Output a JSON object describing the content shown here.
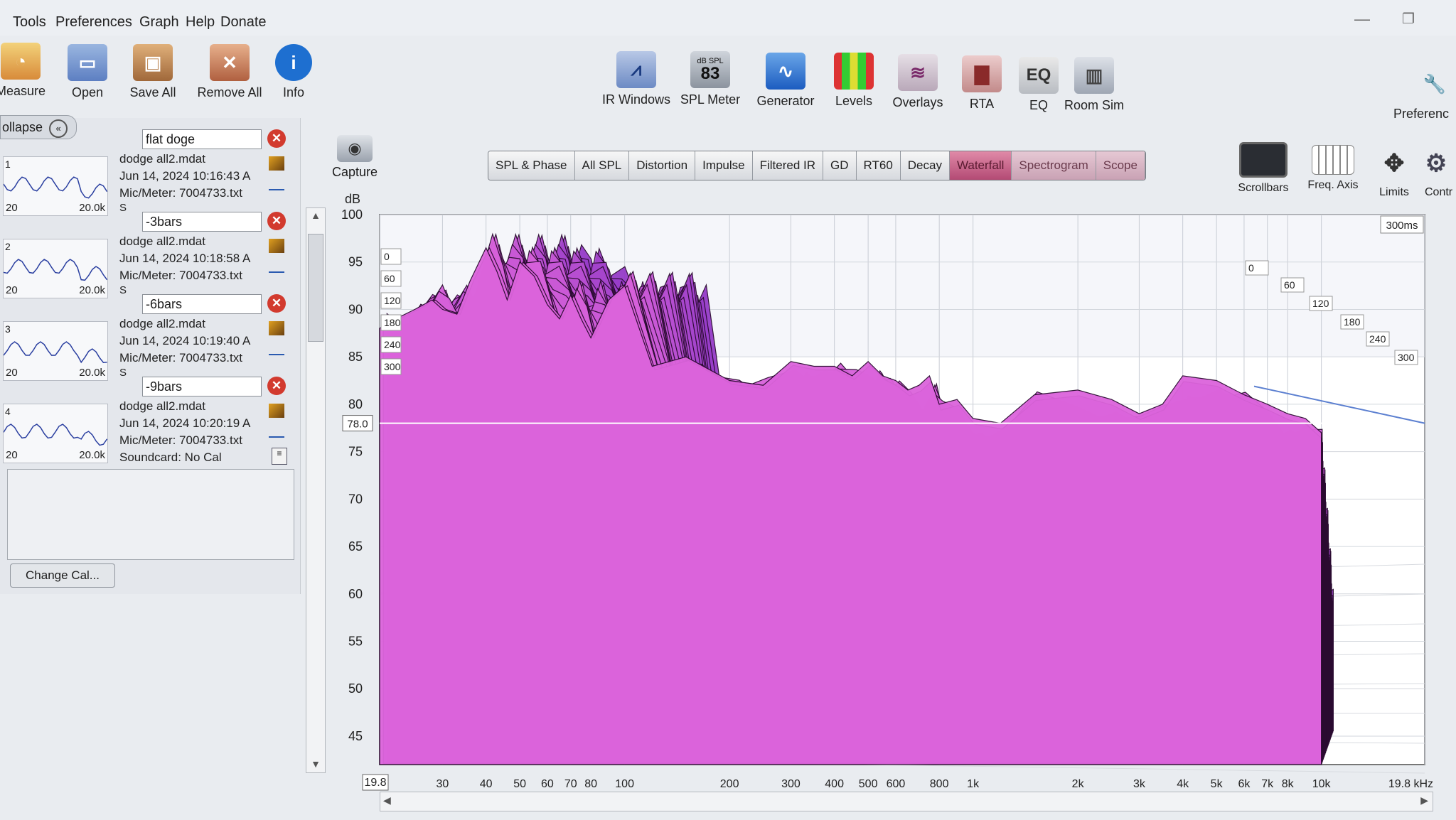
{
  "menu": [
    "Tools",
    "Preferences",
    "Graph",
    "Help",
    "Donate"
  ],
  "toolbar_left": [
    {
      "label": "Measure",
      "icon": "measure-icon"
    },
    {
      "label": "Open",
      "icon": "open-folder-icon"
    },
    {
      "label": "Save All",
      "icon": "save-icon"
    },
    {
      "label": "Remove All",
      "icon": "remove-icon"
    },
    {
      "label": "Info",
      "icon": "info-icon"
    }
  ],
  "toolbar_right": [
    {
      "label": "IR Windows",
      "icon": "ir-windows-icon"
    },
    {
      "label": "SPL Meter",
      "icon": "spl-meter-icon",
      "badge_top": "dB SPL",
      "badge_value": "83"
    },
    {
      "label": "Generator",
      "icon": "generator-icon"
    },
    {
      "label": "Levels",
      "icon": "levels-icon"
    },
    {
      "label": "Overlays",
      "icon": "overlays-icon"
    },
    {
      "label": "RTA",
      "icon": "rta-icon"
    },
    {
      "label": "EQ",
      "icon": "eq-icon",
      "badge_value": "EQ"
    },
    {
      "label": "Room Sim",
      "icon": "room-sim-icon"
    },
    {
      "label": "Preferenc",
      "icon": "preferences-icon"
    }
  ],
  "graph_tools": [
    {
      "label": "Scrollbars",
      "icon": "scrollbars-icon"
    },
    {
      "label": "Freq. Axis",
      "icon": "freq-axis-icon"
    },
    {
      "label": "Limits",
      "icon": "limits-icon"
    },
    {
      "label": "Contr",
      "icon": "controls-icon"
    }
  ],
  "capture": {
    "label": "Capture",
    "icon": "camera-icon"
  },
  "collapse": {
    "label": "ollapse",
    "icon": "double-chevron-left-icon"
  },
  "measurements": [
    {
      "name": "flat doge",
      "number": "1",
      "file": "dodge all2.mdat",
      "date": "Jun 14, 2024 10:16:43 A",
      "mic": "Mic/Meter: 7004733.txt",
      "extra": "S",
      "tmin": "20",
      "tmax": "20.0k"
    },
    {
      "name": "-3bars",
      "number": "2",
      "file": "dodge all2.mdat",
      "date": "Jun 14, 2024 10:18:58 A",
      "mic": "Mic/Meter: 7004733.txt",
      "extra": "S",
      "tmin": "20",
      "tmax": "20.0k"
    },
    {
      "name": "-6bars",
      "number": "3",
      "file": "dodge all2.mdat",
      "date": "Jun 14, 2024 10:19:40 A",
      "mic": "Mic/Meter: 7004733.txt",
      "extra": "S",
      "tmin": "20",
      "tmax": "20.0k"
    },
    {
      "name": "-9bars",
      "number": "4",
      "file": "dodge all2.mdat",
      "date": "Jun 14, 2024 10:20:19 A",
      "mic": "Mic/Meter: 7004733.txt",
      "extra": "Soundcard: No Cal",
      "tmin": "20",
      "tmax": "20.0k"
    }
  ],
  "change_cal": "Change Cal...",
  "tabs": [
    {
      "label": "SPL & Phase",
      "state": "normal"
    },
    {
      "label": "All SPL",
      "state": "normal"
    },
    {
      "label": "Distortion",
      "state": "normal"
    },
    {
      "label": "Impulse",
      "state": "normal"
    },
    {
      "label": "Filtered IR",
      "state": "normal"
    },
    {
      "label": "GD",
      "state": "normal"
    },
    {
      "label": "RT60",
      "state": "normal"
    },
    {
      "label": "Decay",
      "state": "normal"
    },
    {
      "label": "Waterfall",
      "state": "active"
    },
    {
      "label": "Spectrogram",
      "state": "dim"
    },
    {
      "label": "Scope",
      "state": "dim"
    }
  ],
  "chart_data": {
    "type": "area",
    "ylabel": "dB",
    "ylim": [
      42,
      100
    ],
    "yticks": [
      "100",
      "95",
      "90",
      "85",
      "80",
      "75",
      "70",
      "65",
      "60",
      "55",
      "50",
      "45"
    ],
    "cursor_value": "78.0",
    "cursor_db": 78,
    "xscale": "log",
    "xlim": [
      19.8,
      19800
    ],
    "xticks": [
      "19.8",
      "30",
      "40",
      "50",
      "60",
      "70",
      "80",
      "100",
      "200",
      "300",
      "400",
      "500",
      "600",
      "800",
      "1k",
      "2k",
      "3k",
      "4k",
      "5k",
      "6k",
      "7k",
      "8k",
      "10k",
      "19.8 kHz"
    ],
    "xtick_values": [
      19.8,
      30,
      40,
      50,
      60,
      70,
      80,
      100,
      200,
      300,
      400,
      500,
      600,
      800,
      1000,
      2000,
      3000,
      4000,
      5000,
      6000,
      7000,
      8000,
      10000,
      19800
    ],
    "time_label": "300ms",
    "time_slices_front": [
      "0",
      "60",
      "120",
      "180",
      "240",
      "300"
    ],
    "time_slices_back": [
      "0",
      "60",
      "120",
      "180",
      "240",
      "300"
    ],
    "series_color": "#c050d8",
    "front_spectrum": {
      "freq": [
        19.8,
        22,
        25,
        28,
        30,
        33,
        36,
        40,
        43,
        46,
        50,
        55,
        60,
        65,
        70,
        75,
        80,
        90,
        100,
        120,
        150,
        200,
        250,
        300,
        350,
        400,
        450,
        500,
        550,
        600,
        650,
        700,
        750,
        800,
        900,
        1000,
        1200,
        1500,
        2000,
        2500,
        3000,
        3500,
        4000,
        5000,
        6000,
        7000,
        8000,
        9000,
        10000
      ],
      "db": [
        88,
        89,
        90,
        91,
        90,
        89.5,
        93,
        96.5,
        94,
        91,
        95,
        93.5,
        90.5,
        89,
        91.5,
        89,
        87,
        91,
        92.5,
        84,
        85,
        82.5,
        82,
        84.5,
        84,
        84,
        83,
        84.5,
        83,
        82.5,
        81.5,
        82,
        83,
        80,
        80.5,
        78.5,
        78,
        81,
        81.5,
        80.5,
        79,
        80,
        83,
        82.5,
        81,
        80,
        79,
        78.5,
        77
      ]
    }
  },
  "colors": {
    "accent_tab": "#b34a74",
    "waterfall": "#c050d8",
    "waterfall_dark": "#3a1040",
    "delete": "#d23a2e"
  }
}
